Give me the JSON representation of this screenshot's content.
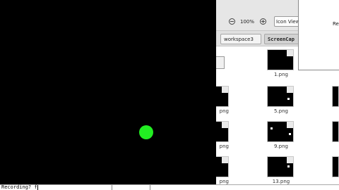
{
  "file_manager": {
    "zoom_level": "100%",
    "view_mode": "Icon View",
    "path_buttons": [
      "workspace3",
      "ScreenCap"
    ],
    "files": [
      {
        "name": "1.png"
      },
      {
        "name": "5.png"
      },
      {
        "name": "9.png"
      },
      {
        "name": "13.png"
      },
      {
        "name": "png"
      },
      {
        "name": "png"
      },
      {
        "name": "png"
      }
    ]
  },
  "popup": {
    "text": "Re"
  },
  "terminal": {
    "prompt": "Recording? f"
  },
  "colors": {
    "black_window": "#000000",
    "green_dot": "#22ee22"
  }
}
